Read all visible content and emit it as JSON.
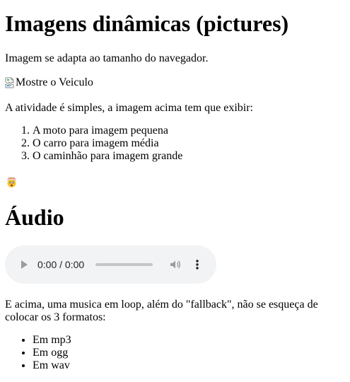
{
  "pictures_section": {
    "heading": "Imagens dinâmicas (pictures)",
    "intro": "Imagem se adapta ao tamanho do navegador.",
    "image_alt": "Mostre o Veiculo",
    "activity_text": "A atividade é simples, a imagem acima tem que exibir:",
    "activity_items": [
      "A moto para imagem pequena",
      "O carro para imagem média",
      "O caminhão para imagem grande"
    ],
    "emoji": "exploding-head-emoji"
  },
  "audio_section": {
    "heading": "Áudio",
    "player": {
      "time": "0:00 / 0:00",
      "progress": 0,
      "icons": [
        "play-icon",
        "volume-icon",
        "more-options-icon"
      ]
    },
    "description": "E acima, uma musica em loop, além do \"fallback\", não se esqueça de colocar os 3 formatos:",
    "formats": [
      "Em mp3",
      "Em ogg",
      "Em wav"
    ]
  }
}
